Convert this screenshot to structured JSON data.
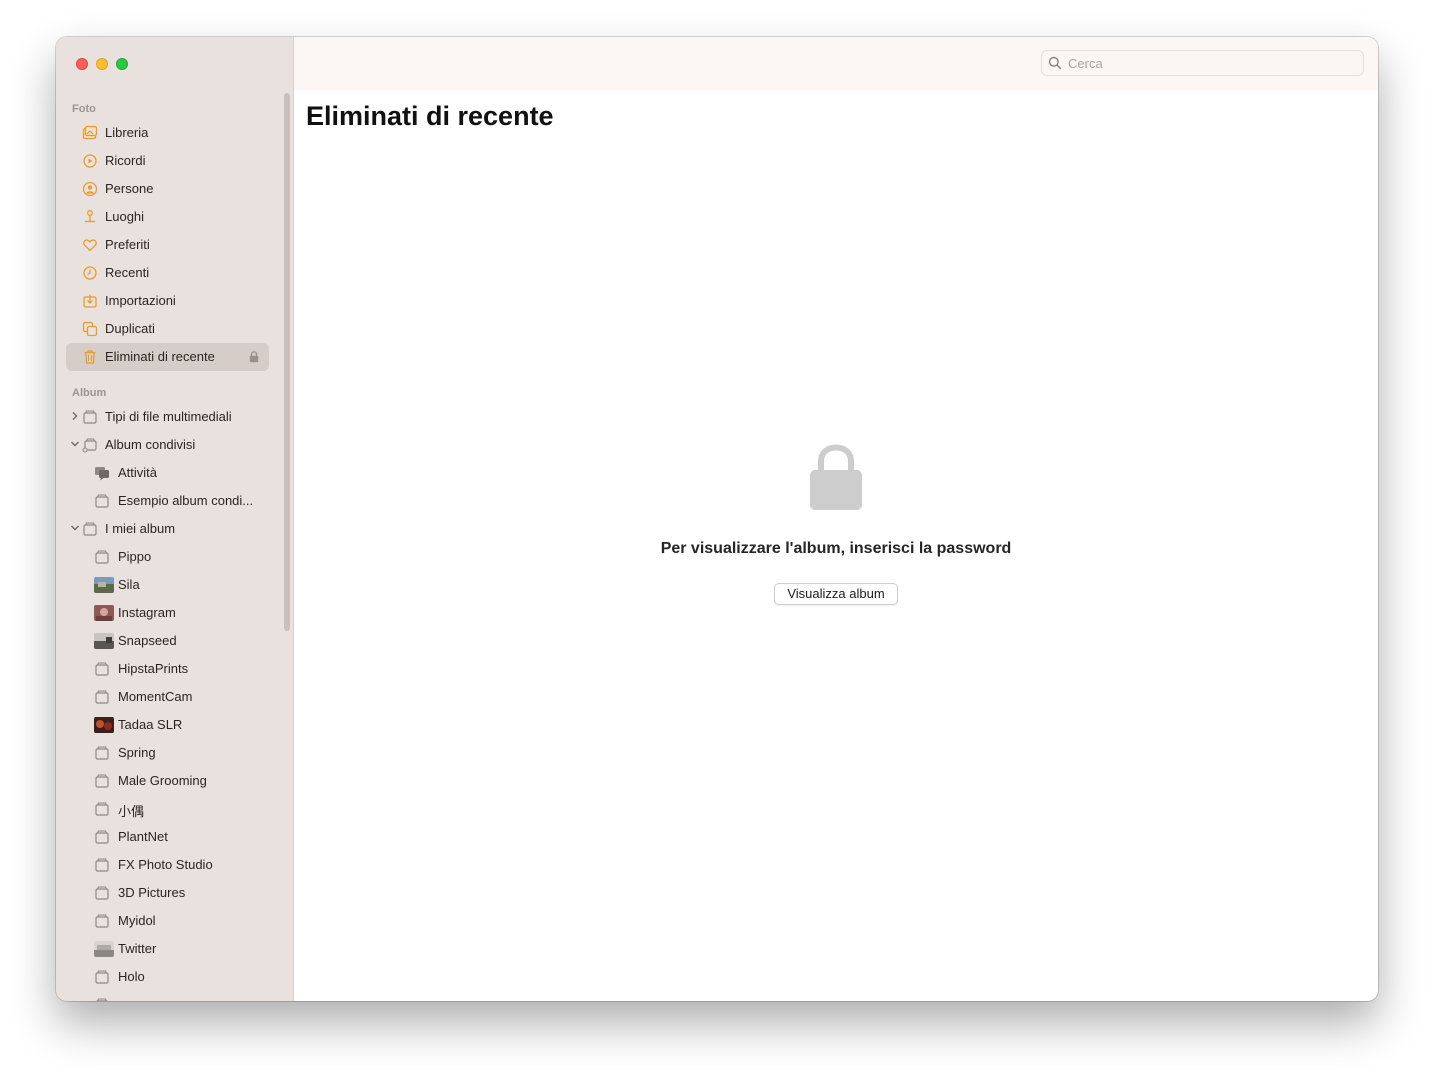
{
  "window": {
    "traffic_lights": [
      "close",
      "minimize",
      "zoom"
    ]
  },
  "sidebar": {
    "photos_section": {
      "label": "Foto",
      "items": [
        {
          "label": "Libreria",
          "icon": "library-icon"
        },
        {
          "label": "Ricordi",
          "icon": "memories-icon"
        },
        {
          "label": "Persone",
          "icon": "people-icon"
        },
        {
          "label": "Luoghi",
          "icon": "places-icon"
        },
        {
          "label": "Preferiti",
          "icon": "heart-icon"
        },
        {
          "label": "Recenti",
          "icon": "clock-icon"
        },
        {
          "label": "Importazioni",
          "icon": "import-icon"
        },
        {
          "label": "Duplicati",
          "icon": "duplicates-icon"
        },
        {
          "label": "Eliminati di recente",
          "icon": "trash-icon",
          "selected": true,
          "locked": true
        }
      ]
    },
    "albums_section": {
      "label": "Album",
      "items": [
        {
          "label": "Tipi di file multimediali",
          "disclosure": "collapsed"
        },
        {
          "label": "Album condivisi",
          "disclosure": "expanded"
        },
        {
          "label": "Attività"
        },
        {
          "label": "Esempio album condi..."
        },
        {
          "label": "I miei album",
          "disclosure": "expanded"
        },
        {
          "label": "Pippo"
        },
        {
          "label": "Sila"
        },
        {
          "label": "Instagram"
        },
        {
          "label": "Snapseed"
        },
        {
          "label": "HipstaPrints"
        },
        {
          "label": "MomentCam"
        },
        {
          "label": "Tadaa SLR"
        },
        {
          "label": "Spring"
        },
        {
          "label": "Male Grooming"
        },
        {
          "label": "小偶"
        },
        {
          "label": "PlantNet"
        },
        {
          "label": "FX Photo Studio"
        },
        {
          "label": "3D Pictures"
        },
        {
          "label": "Myidol"
        },
        {
          "label": "Twitter"
        },
        {
          "label": "Holo"
        }
      ]
    }
  },
  "toolbar": {
    "search_placeholder": "Cerca"
  },
  "main": {
    "title": "Eliminati di recente",
    "message": "Per visualizzare l'album, inserisci la password",
    "button_label": "Visualizza album"
  },
  "colors": {
    "accent": "#e89b2f",
    "sidebar_bg": "#e9e1de",
    "selection": "#d6cdc9",
    "lock_gray": "#cdcdcd"
  }
}
